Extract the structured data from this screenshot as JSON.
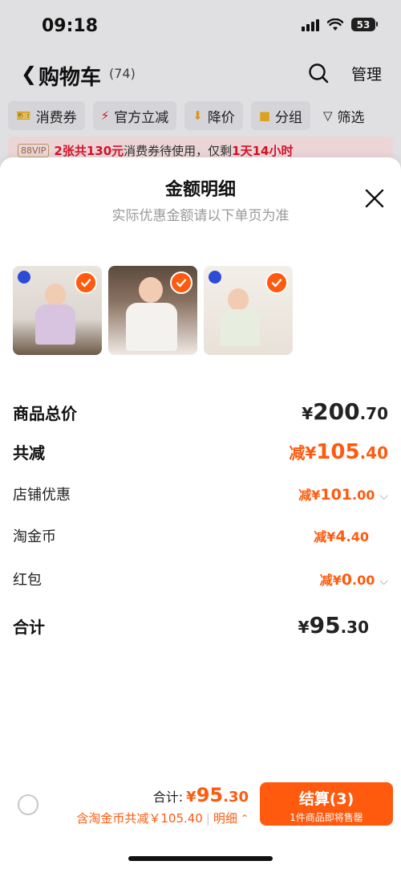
{
  "status_bar": {
    "time": "09:18",
    "battery": "53"
  },
  "nav": {
    "title": "购物车",
    "count": "(74)",
    "manage": "管理"
  },
  "filters": [
    {
      "label": "消费券",
      "icon": "coupon-icon"
    },
    {
      "label": "官方立减",
      "icon": "lightning-icon"
    },
    {
      "label": "降价",
      "icon": "arrow-down-icon"
    },
    {
      "label": "分组",
      "icon": "folder-icon"
    },
    {
      "label": "筛选",
      "icon": "filter-icon"
    }
  ],
  "vip_banner": {
    "badge": "88VIP",
    "highlight": "2张共130元",
    "middle": "消费券待使用，仅剩",
    "time_left": "1天14小时"
  },
  "sheet": {
    "title": "金额明细",
    "subtitle": "实际优惠金额请以下单页为准",
    "products": [
      {
        "name": "product-thumb-1",
        "checked": true
      },
      {
        "name": "product-thumb-2",
        "checked": true
      },
      {
        "name": "product-thumb-3",
        "checked": true
      }
    ],
    "rows": {
      "total_price": {
        "label": "商品总价",
        "currency": "¥",
        "int": "200",
        "dec": ".70"
      },
      "total_discount": {
        "label": "共减",
        "prefix": "减¥",
        "int": "105",
        "dec": ".40"
      },
      "store_discount": {
        "label": "店铺优惠",
        "prefix": "减¥",
        "int": "101",
        "dec": ".00"
      },
      "coins": {
        "label": "淘金币",
        "prefix": "减¥",
        "int": "4",
        "dec": ".40"
      },
      "red_packet": {
        "label": "红包",
        "prefix": "减¥",
        "int": "0",
        "dec": ".00"
      },
      "sum": {
        "label": "合计",
        "currency": "¥",
        "int": "95",
        "dec": ".30"
      }
    }
  },
  "bottom_bar": {
    "sum_label": "合计:",
    "sum_currency": "¥",
    "sum_int": "95",
    "sum_dec": ".30",
    "discount_text": "含淘金币共减￥105.40",
    "divider": "|",
    "detail_label": "明细",
    "checkout_label": "结算(3)",
    "checkout_sub": "1件商品即将售罄"
  },
  "colors": {
    "accent": "#ff5a0e",
    "vip_red": "#e8142d"
  }
}
